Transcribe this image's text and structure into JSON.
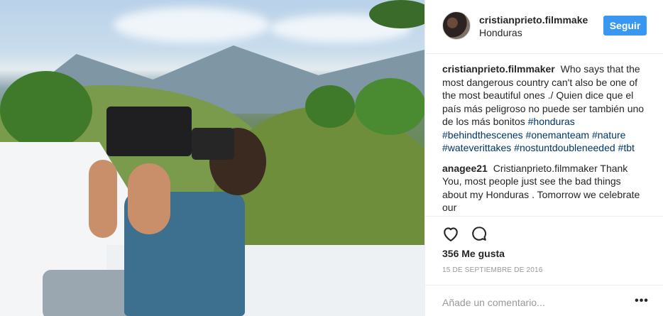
{
  "photo": {
    "alt": ""
  },
  "header": {
    "username": "cristianprieto.filmmake",
    "location": "Honduras",
    "follow_label": "Seguir"
  },
  "caption": {
    "author": "cristianprieto.filmmaker",
    "text": "Who says that the most dangerous country can't also be one of the most beautiful ones ./ Quien dice que el país más peligroso no puede ser también uno de los más bonitos",
    "hashtags": [
      "#honduras",
      "#behindthescenes",
      "#onemanteam",
      "#nature",
      "#wateverittakes",
      "#nostuntdoubleneeded",
      "#tbt"
    ]
  },
  "comments": [
    {
      "author": "anagee21",
      "text": "Cristianprieto.filmmaker Thank You, most people just see the bad things about my Honduras . Tomorrow we celebrate our"
    }
  ],
  "actions": {
    "like_icon": "heart-icon",
    "comment_icon": "comment-bubble-icon",
    "likes_text": "356 Me gusta",
    "date": "15 DE SEPTIEMBRE DE 2016"
  },
  "add_comment": {
    "placeholder": "Añade un comentario...",
    "more_label": "•••"
  }
}
